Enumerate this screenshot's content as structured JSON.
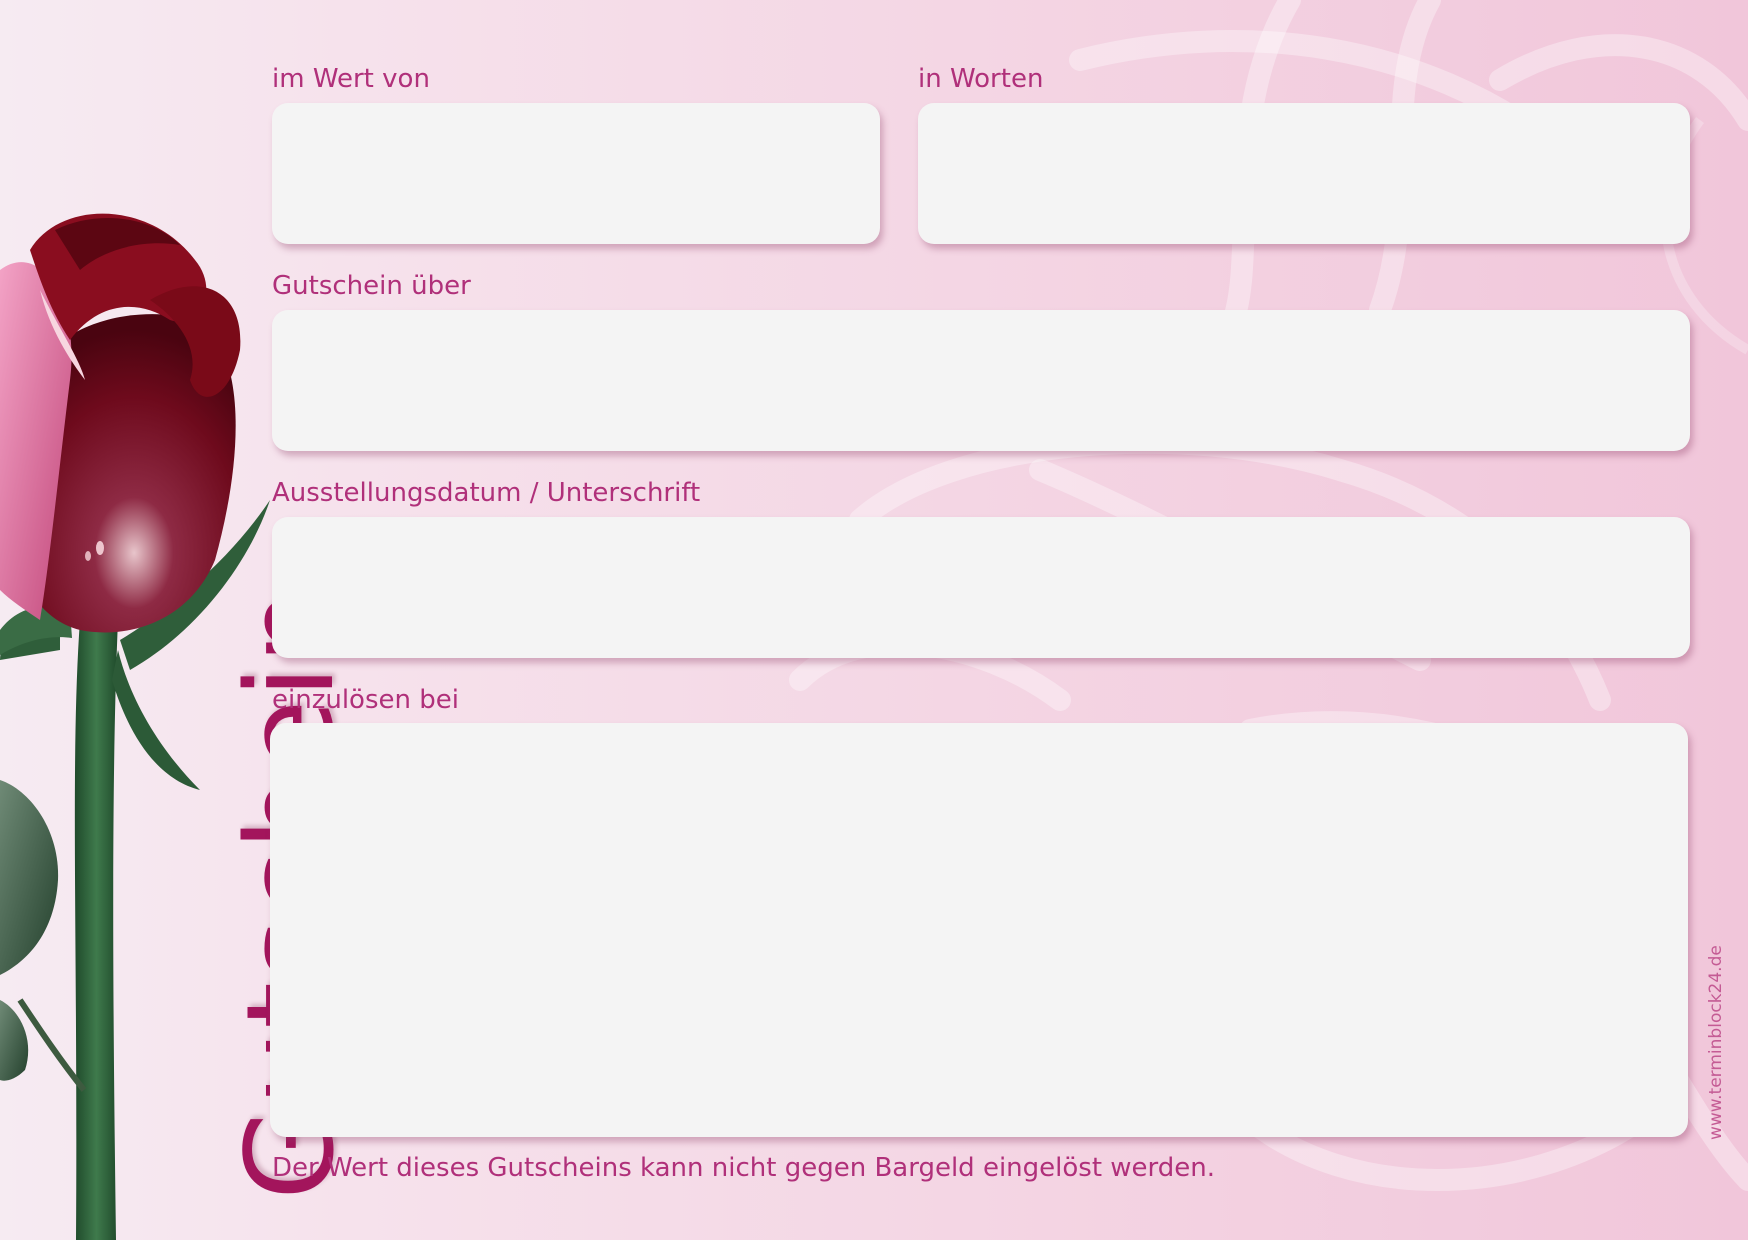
{
  "voucher": {
    "title": "Gutschein",
    "fields": [
      {
        "label": "im Wert von",
        "value": ""
      },
      {
        "label": "in Worten",
        "value": ""
      },
      {
        "label": "Gutschein über",
        "value": ""
      },
      {
        "label": "Ausstellungsdatum / Unterschrift",
        "value": ""
      },
      {
        "label": "einzulösen bei",
        "value": ""
      }
    ],
    "disclaimer": "Der Wert dieses Gutscheins kann nicht gegen Bargeld eingelöst werden.",
    "website": "www.terminblock24.de"
  },
  "colors": {
    "accent": "#a3155c",
    "label": "#b0307a",
    "field": "#f4f4f4",
    "background_light": "#f6ebf2",
    "background_pink": "#f1c6da",
    "rose_dark": "#7a0a18",
    "leaf": "#2f5e3a"
  },
  "decoration": {
    "icon": "rose-illustration"
  }
}
